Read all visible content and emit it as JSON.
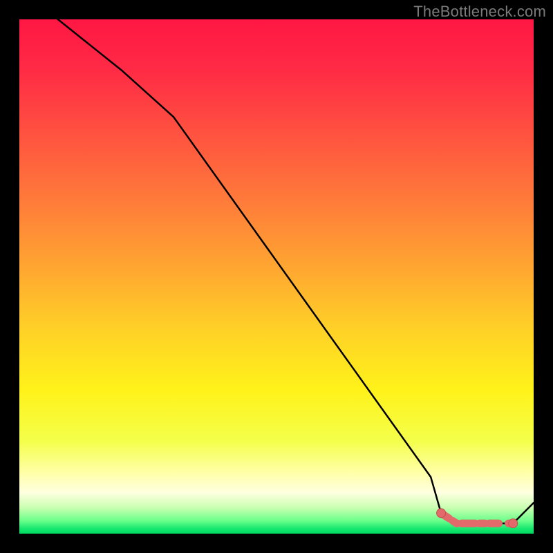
{
  "credit_text": "TheBottleneck.com",
  "colors": {
    "black": "#000000",
    "line": "#000000",
    "marker_fill": "#e26a6a",
    "marker_stroke": "#c94f4f",
    "gradient_stops": [
      {
        "offset": "0%",
        "color": "#ff1744"
      },
      {
        "offset": "10%",
        "color": "#ff2b45"
      },
      {
        "offset": "22%",
        "color": "#ff5140"
      },
      {
        "offset": "35%",
        "color": "#ff7a3a"
      },
      {
        "offset": "48%",
        "color": "#ffa531"
      },
      {
        "offset": "60%",
        "color": "#ffd027"
      },
      {
        "offset": "72%",
        "color": "#fff21a"
      },
      {
        "offset": "82%",
        "color": "#f4ff4a"
      },
      {
        "offset": "88%",
        "color": "#ffffa6"
      },
      {
        "offset": "92%",
        "color": "#ffffe0"
      },
      {
        "offset": "95%",
        "color": "#c8ffb0"
      },
      {
        "offset": "97.5%",
        "color": "#6aff8a"
      },
      {
        "offset": "99%",
        "color": "#18e870"
      },
      {
        "offset": "100%",
        "color": "#00d860"
      }
    ]
  },
  "chart_data": {
    "type": "line",
    "title": "",
    "xlabel": "",
    "ylabel": "",
    "xlim": [
      0,
      100
    ],
    "ylim": [
      0,
      100
    ],
    "x": [
      0,
      10,
      20,
      30,
      40,
      50,
      60,
      70,
      80,
      82,
      85,
      88,
      90,
      92,
      94,
      96,
      100
    ],
    "values": [
      106,
      98,
      90,
      81,
      67,
      53,
      39,
      25,
      11,
      4,
      2,
      2,
      2,
      2,
      2,
      2,
      6
    ],
    "markers": {
      "x": [
        82,
        85,
        88,
        90,
        92,
        94,
        96
      ],
      "values": [
        4,
        2,
        2,
        2,
        2,
        2,
        2
      ]
    }
  }
}
